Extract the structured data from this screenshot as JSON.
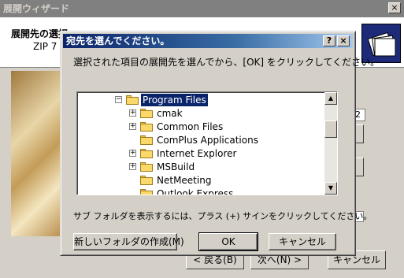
{
  "wizard": {
    "title": "展開ウィザード",
    "close_glyph": "×",
    "header_title": "展開先の選択",
    "header_subtitle": "ZIP 7",
    "field_fragment": "2",
    "back_label": "< 戻る(B)",
    "next_label": "次へ(N) >",
    "cancel_label": "キャンセル"
  },
  "dialog": {
    "title": "宛先を選んでください。",
    "help_glyph": "?",
    "close_glyph": "×",
    "instruction": "選択された項目の展開先を選んでから、[OK] をクリックしてください。",
    "tree": [
      {
        "label": "Program Files",
        "level": 0,
        "expander": "−",
        "selected": true
      },
      {
        "label": "cmak",
        "level": 1,
        "expander": "+",
        "selected": false
      },
      {
        "label": "Common Files",
        "level": 1,
        "expander": "+",
        "selected": false
      },
      {
        "label": "ComPlus Applications",
        "level": 1,
        "expander": "",
        "selected": false
      },
      {
        "label": "Internet Explorer",
        "level": 1,
        "expander": "+",
        "selected": false
      },
      {
        "label": "MSBuild",
        "level": 1,
        "expander": "+",
        "selected": false
      },
      {
        "label": "NetMeeting",
        "level": 1,
        "expander": "",
        "selected": false
      },
      {
        "label": "Outlook Express",
        "level": 1,
        "expander": "",
        "selected": false
      }
    ],
    "scroll_up_glyph": "▲",
    "scroll_down_glyph": "▼",
    "hint": "サブ フォルダを表示するには、プラス (+) サインをクリックしてください。",
    "new_folder_label": "新しいフォルダの作成(M)",
    "ok_label": "OK",
    "cancel_label": "キャンセル"
  },
  "colors": {
    "titlebar_active": "#0a246a",
    "titlebar_inactive": "#808080",
    "face": "#d4d0c8",
    "selection": "#0a246a"
  }
}
